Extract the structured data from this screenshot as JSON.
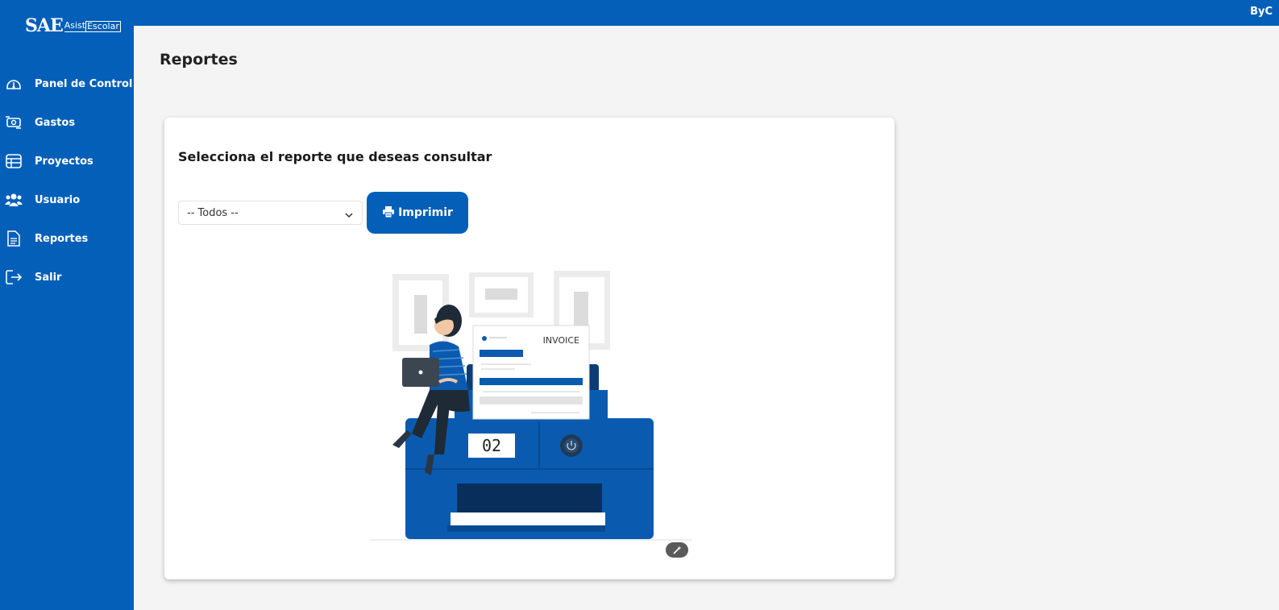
{
  "app": {
    "logo_main": "SAE",
    "logo_sub_1": "Asist",
    "logo_sub_2": "Escolar",
    "user": "ByC"
  },
  "sidebar": {
    "items": [
      {
        "label": "Panel de Control",
        "icon": "dashboard-icon"
      },
      {
        "label": "Gastos",
        "icon": "money-exchange-icon"
      },
      {
        "label": "Proyectos",
        "icon": "table-icon"
      },
      {
        "label": "Usuario",
        "icon": "users-icon"
      },
      {
        "label": "Reportes",
        "icon": "document-icon"
      },
      {
        "label": "Salir",
        "icon": "logout-icon"
      }
    ]
  },
  "page": {
    "title": "Reportes"
  },
  "report": {
    "heading": "Selecciona el reporte que deseas consultar",
    "select_value": "-- Todos --",
    "print_label": "Imprimir"
  },
  "illustration": {
    "invoice_title": "INVOICE",
    "counter": "02"
  },
  "colors": {
    "primary": "#045fb8",
    "background": "#f4f4f4"
  }
}
